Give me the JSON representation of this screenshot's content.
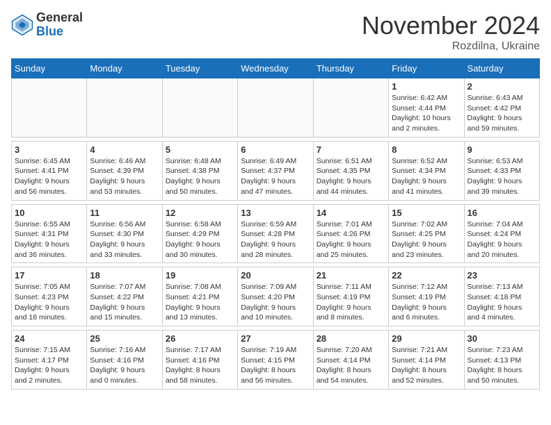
{
  "logo": {
    "general": "General",
    "blue": "Blue"
  },
  "header": {
    "month": "November 2024",
    "location": "Rozdilna, Ukraine"
  },
  "weekdays": [
    "Sunday",
    "Monday",
    "Tuesday",
    "Wednesday",
    "Thursday",
    "Friday",
    "Saturday"
  ],
  "weeks": [
    [
      {
        "day": "",
        "info": ""
      },
      {
        "day": "",
        "info": ""
      },
      {
        "day": "",
        "info": ""
      },
      {
        "day": "",
        "info": ""
      },
      {
        "day": "",
        "info": ""
      },
      {
        "day": "1",
        "info": "Sunrise: 6:42 AM\nSunset: 4:44 PM\nDaylight: 10 hours\nand 2 minutes."
      },
      {
        "day": "2",
        "info": "Sunrise: 6:43 AM\nSunset: 4:42 PM\nDaylight: 9 hours\nand 59 minutes."
      }
    ],
    [
      {
        "day": "3",
        "info": "Sunrise: 6:45 AM\nSunset: 4:41 PM\nDaylight: 9 hours\nand 56 minutes."
      },
      {
        "day": "4",
        "info": "Sunrise: 6:46 AM\nSunset: 4:39 PM\nDaylight: 9 hours\nand 53 minutes."
      },
      {
        "day": "5",
        "info": "Sunrise: 6:48 AM\nSunset: 4:38 PM\nDaylight: 9 hours\nand 50 minutes."
      },
      {
        "day": "6",
        "info": "Sunrise: 6:49 AM\nSunset: 4:37 PM\nDaylight: 9 hours\nand 47 minutes."
      },
      {
        "day": "7",
        "info": "Sunrise: 6:51 AM\nSunset: 4:35 PM\nDaylight: 9 hours\nand 44 minutes."
      },
      {
        "day": "8",
        "info": "Sunrise: 6:52 AM\nSunset: 4:34 PM\nDaylight: 9 hours\nand 41 minutes."
      },
      {
        "day": "9",
        "info": "Sunrise: 6:53 AM\nSunset: 4:33 PM\nDaylight: 9 hours\nand 39 minutes."
      }
    ],
    [
      {
        "day": "10",
        "info": "Sunrise: 6:55 AM\nSunset: 4:31 PM\nDaylight: 9 hours\nand 36 minutes."
      },
      {
        "day": "11",
        "info": "Sunrise: 6:56 AM\nSunset: 4:30 PM\nDaylight: 9 hours\nand 33 minutes."
      },
      {
        "day": "12",
        "info": "Sunrise: 6:58 AM\nSunset: 4:29 PM\nDaylight: 9 hours\nand 30 minutes."
      },
      {
        "day": "13",
        "info": "Sunrise: 6:59 AM\nSunset: 4:28 PM\nDaylight: 9 hours\nand 28 minutes."
      },
      {
        "day": "14",
        "info": "Sunrise: 7:01 AM\nSunset: 4:26 PM\nDaylight: 9 hours\nand 25 minutes."
      },
      {
        "day": "15",
        "info": "Sunrise: 7:02 AM\nSunset: 4:25 PM\nDaylight: 9 hours\nand 23 minutes."
      },
      {
        "day": "16",
        "info": "Sunrise: 7:04 AM\nSunset: 4:24 PM\nDaylight: 9 hours\nand 20 minutes."
      }
    ],
    [
      {
        "day": "17",
        "info": "Sunrise: 7:05 AM\nSunset: 4:23 PM\nDaylight: 9 hours\nand 18 minutes."
      },
      {
        "day": "18",
        "info": "Sunrise: 7:07 AM\nSunset: 4:22 PM\nDaylight: 9 hours\nand 15 minutes."
      },
      {
        "day": "19",
        "info": "Sunrise: 7:08 AM\nSunset: 4:21 PM\nDaylight: 9 hours\nand 13 minutes."
      },
      {
        "day": "20",
        "info": "Sunrise: 7:09 AM\nSunset: 4:20 PM\nDaylight: 9 hours\nand 10 minutes."
      },
      {
        "day": "21",
        "info": "Sunrise: 7:11 AM\nSunset: 4:19 PM\nDaylight: 9 hours\nand 8 minutes."
      },
      {
        "day": "22",
        "info": "Sunrise: 7:12 AM\nSunset: 4:19 PM\nDaylight: 9 hours\nand 6 minutes."
      },
      {
        "day": "23",
        "info": "Sunrise: 7:13 AM\nSunset: 4:18 PM\nDaylight: 9 hours\nand 4 minutes."
      }
    ],
    [
      {
        "day": "24",
        "info": "Sunrise: 7:15 AM\nSunset: 4:17 PM\nDaylight: 9 hours\nand 2 minutes."
      },
      {
        "day": "25",
        "info": "Sunrise: 7:16 AM\nSunset: 4:16 PM\nDaylight: 9 hours\nand 0 minutes."
      },
      {
        "day": "26",
        "info": "Sunrise: 7:17 AM\nSunset: 4:16 PM\nDaylight: 8 hours\nand 58 minutes."
      },
      {
        "day": "27",
        "info": "Sunrise: 7:19 AM\nSunset: 4:15 PM\nDaylight: 8 hours\nand 56 minutes."
      },
      {
        "day": "28",
        "info": "Sunrise: 7:20 AM\nSunset: 4:14 PM\nDaylight: 8 hours\nand 54 minutes."
      },
      {
        "day": "29",
        "info": "Sunrise: 7:21 AM\nSunset: 4:14 PM\nDaylight: 8 hours\nand 52 minutes."
      },
      {
        "day": "30",
        "info": "Sunrise: 7:23 AM\nSunset: 4:13 PM\nDaylight: 8 hours\nand 50 minutes."
      }
    ]
  ]
}
